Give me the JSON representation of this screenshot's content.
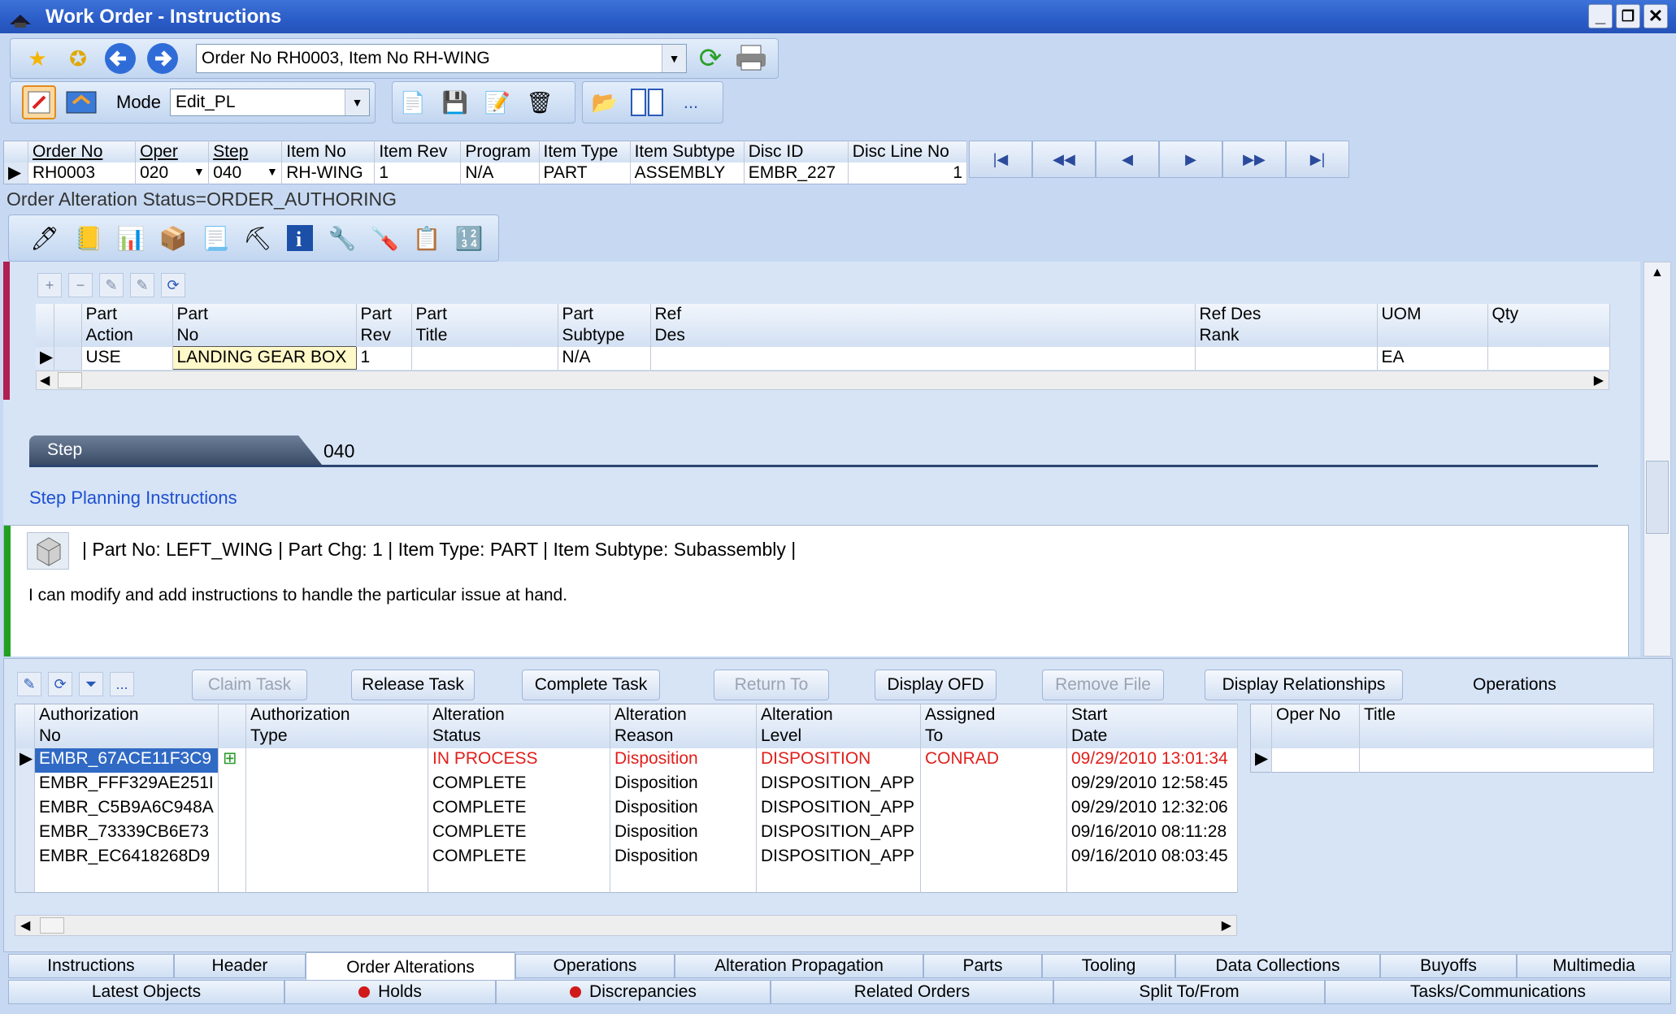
{
  "window": {
    "title": "Work Order - Instructions"
  },
  "toolbar1": {
    "order_combo": "Order No  RH0003, Item No  RH-WING"
  },
  "toolbar2": {
    "mode_label": "Mode",
    "mode_value": "Edit_PL",
    "more_label": "..."
  },
  "order_grid": {
    "headers": [
      "Order No",
      "Oper",
      "Step",
      "Item No",
      "Item Rev",
      "Program",
      "Item Type",
      "Item Subtype",
      "Disc ID",
      "Disc Line No"
    ],
    "row": [
      "RH0003",
      "020",
      "040",
      "RH-WING",
      "1",
      "N/A",
      "PART",
      "ASSEMBLY",
      "EMBR_227",
      "1"
    ]
  },
  "status_text": "Order Alteration Status=ORDER_AUTHORING",
  "parts_grid": {
    "headers": [
      "Part\nAction",
      "Part\nNo",
      "Part\nRev",
      "Part\nTitle",
      "Part\nSubtype",
      "Ref\nDes",
      "Ref Des\nRank",
      "UOM",
      "Qty"
    ],
    "row": [
      "USE",
      "LANDING GEAR BOX",
      "1",
      "",
      "N/A",
      "",
      "",
      "EA",
      ""
    ]
  },
  "step": {
    "label": "Step",
    "value": "040"
  },
  "planning": {
    "link": "Step Planning Instructions",
    "info": "| Part No: LEFT_WING | Part Chg: 1 | Item Type: PART | Item Subtype: Subassembly |",
    "body": "I can modify and add instructions to handle the particular issue at hand."
  },
  "actions": {
    "more": "...",
    "claim": "Claim Task",
    "release": "Release Task",
    "complete": "Complete Task",
    "return_to": "Return To",
    "display_ofd": "Display OFD",
    "remove_file": "Remove File",
    "display_rel": "Display Relationships",
    "operations_label": "Operations"
  },
  "alterations": {
    "headers": [
      "Authorization\nNo",
      "Authorization\nType",
      "Alteration\nStatus",
      "Alteration\nReason",
      "Alteration\nLevel",
      "Assigned\nTo",
      "Start\nDate"
    ],
    "rows": [
      [
        "EMBR_67ACE11F3C9",
        "",
        "IN PROCESS",
        "Disposition",
        "DISPOSITION",
        "CONRAD",
        "09/29/2010 13:01:34"
      ],
      [
        "EMBR_FFF329AE251I",
        "",
        "COMPLETE",
        "Disposition",
        "DISPOSITION_APP",
        "",
        "09/29/2010 12:58:45"
      ],
      [
        "EMBR_C5B9A6C948A",
        "",
        "COMPLETE",
        "Disposition",
        "DISPOSITION_APP",
        "",
        "09/29/2010 12:32:06"
      ],
      [
        "EMBR_73339CB6E73",
        "",
        "COMPLETE",
        "Disposition",
        "DISPOSITION_APP",
        "",
        "09/16/2010 08:11:28"
      ],
      [
        "EMBR_EC6418268D9",
        "",
        "COMPLETE",
        "Disposition",
        "DISPOSITION_APP",
        "",
        "09/16/2010 08:03:45"
      ]
    ]
  },
  "operations_grid": {
    "headers": [
      "Oper No",
      "Title"
    ]
  },
  "tabs_row1": [
    "Instructions",
    "Header",
    "Order Alterations",
    "Operations",
    "Alteration Propagation",
    "Parts",
    "Tooling",
    "Data Collections",
    "Buyoffs",
    "Multimedia"
  ],
  "tabs_row2": [
    "Latest Objects",
    "Holds",
    "Discrepancies",
    "Related Orders",
    "Split To/From",
    "Tasks/Communications"
  ],
  "colors": {
    "title_bar": "#2b5cc7",
    "background": "#c7d9f2",
    "alert_red": "#e0201c",
    "selection": "#316ac5"
  }
}
